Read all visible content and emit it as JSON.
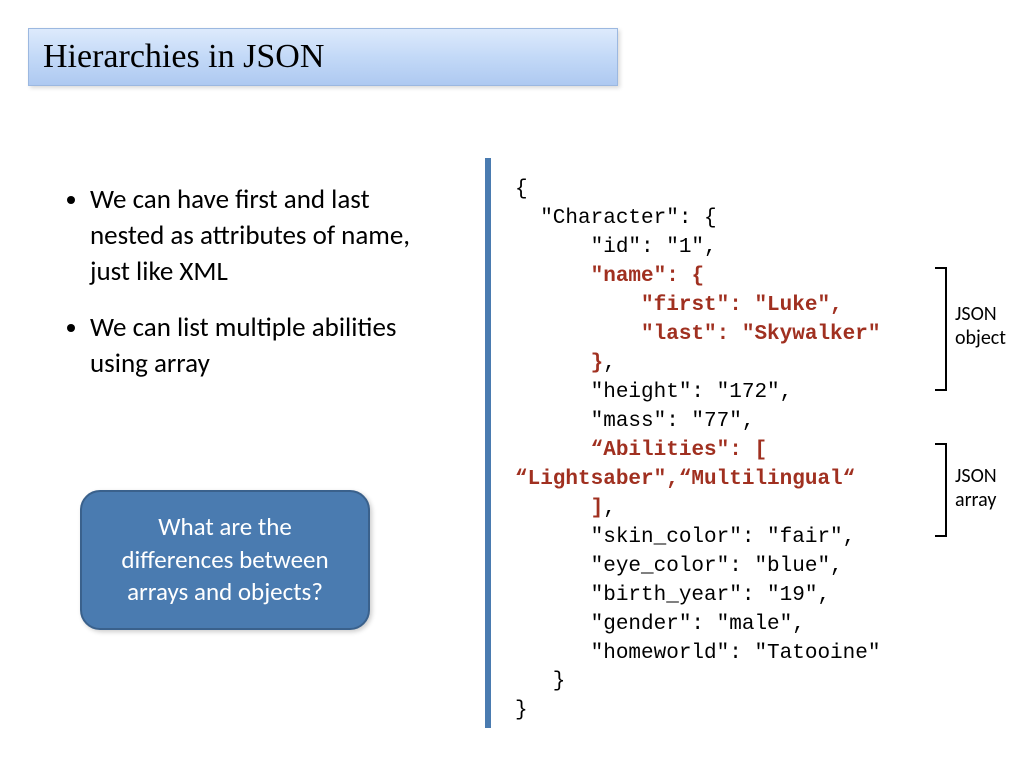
{
  "title": "Hierarchies in JSON",
  "bullets": [
    "We can have first and last nested as attributes of name, just like XML",
    "We can list multiple abilities using array"
  ],
  "callout": "What are the differences between arrays and objects?",
  "code": {
    "l1": "{",
    "l2": "  \"Character\": {",
    "l3": "      \"id\": \"1\",",
    "l4a": "      ",
    "l4b": "\"name\": {",
    "l5a": "          ",
    "l5b": "\"first\": \"Luke\",",
    "l6a": "          ",
    "l6b": "\"last\": \"Skywalker\"",
    "l7a": "      ",
    "l7b": "}",
    "l7c": ",",
    "l8": "      \"height\": \"172\",",
    "l9": "      \"mass\": \"77\",",
    "l10a": "      ",
    "l10b": "“Abilities\": [",
    "l11a": "“Lightsaber\",“Multilingual“",
    "l12a": "      ",
    "l12b": "]",
    "l12c": ",",
    "l13": "      \"skin_color\": \"fair\",",
    "l14": "      \"eye_color\": \"blue\",",
    "l15": "      \"birth_year\": \"19\",",
    "l16": "      \"gender\": \"male\",",
    "l17": "      \"homeworld\": \"Tatooine\"",
    "l18": "   }",
    "l19": "}"
  },
  "labels": {
    "obj1": "JSON",
    "obj2": "object",
    "arr1": "JSON",
    "arr2": "array"
  }
}
